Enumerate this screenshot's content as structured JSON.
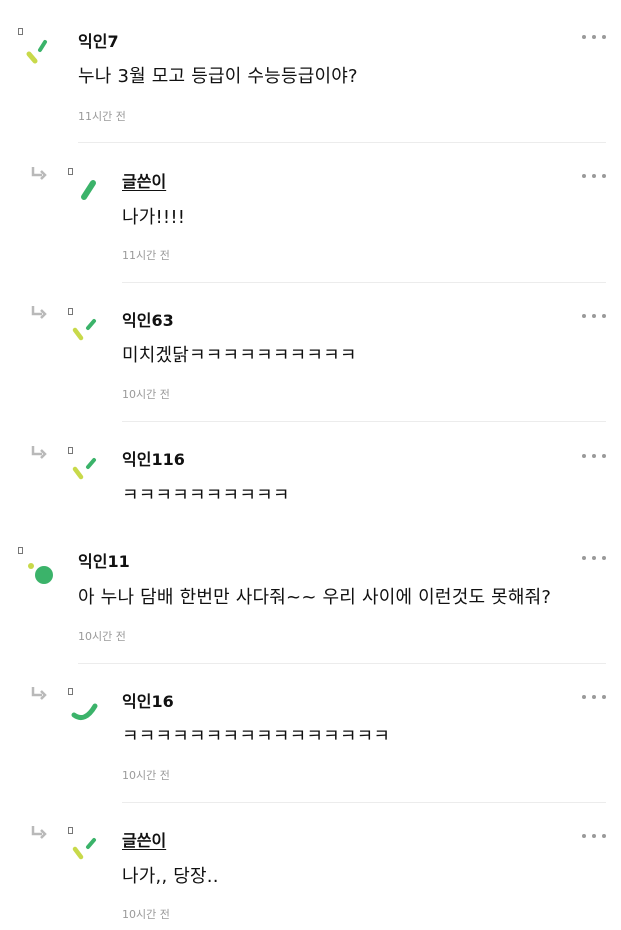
{
  "comments": [
    {
      "name": "익인7",
      "text": "누나 3월 모고 등급이 수능등급이야?",
      "time": "11시간 전",
      "avatar": "yellow-green-dash"
    },
    {
      "name": "글쓴이",
      "text": "나가!!!!",
      "time": "11시간 전",
      "avatar": "green-bar",
      "is_author": true
    },
    {
      "name": "익인63",
      "text": "미치겠닭ㅋㅋㅋㅋㅋㅋㅋㅋㅋㅋ",
      "time": "10시간 전",
      "avatar": "yellow-green-dash"
    },
    {
      "name": "익인116",
      "text": "ㅋㅋㅋㅋㅋㅋㅋㅋㅋㅋ",
      "avatar": "yellow-green-dash"
    },
    {
      "name": "익인11",
      "text": "아 누나 담배 한번만 사다줘~~ 우리 사이에 이런것도 못해줘?",
      "time": "10시간 전",
      "avatar": "green-dots"
    },
    {
      "name": "익인16",
      "text": "ㅋㅋㅋㅋㅋㅋㅋㅋㅋㅋㅋㅋㅋㅋㅋㅋ",
      "time": "10시간 전",
      "avatar": "green-arc"
    },
    {
      "name": "글쓴이",
      "text": "나가,, 당장..",
      "time": "10시간 전",
      "avatar": "yellow-green-dash",
      "is_author": true
    }
  ],
  "icons": {
    "more": "more-dots-icon",
    "reply": "reply-arrow-icon"
  },
  "colors": {
    "accent_green": "#3bb36a",
    "lime": "#c8d94a",
    "meta_gray": "#9a9a9a"
  }
}
